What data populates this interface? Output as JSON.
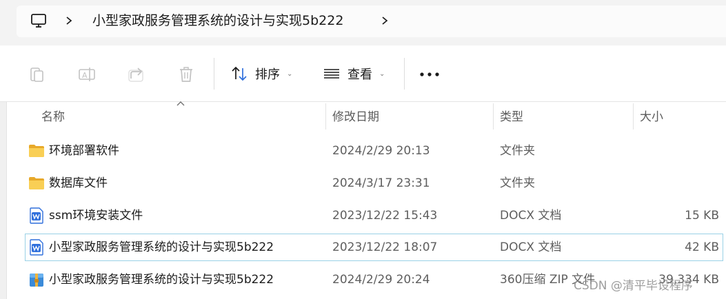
{
  "address_bar": {
    "breadcrumb": "小型家政服务管理系统的设计与实现5b222"
  },
  "toolbar": {
    "sort_label": "排序",
    "view_label": "查看",
    "icons": [
      "copy-icon",
      "rename-icon",
      "share-icon",
      "delete-icon",
      "sort-icon",
      "view-icon",
      "more-icon"
    ]
  },
  "columns": {
    "name": "名称",
    "modified": "修改日期",
    "type": "类型",
    "size": "大小"
  },
  "files": [
    {
      "name": "环境部署软件",
      "modified": "2024/2/29 20:13",
      "type": "文件夹",
      "size": "",
      "icon": "folder-icon"
    },
    {
      "name": "数据库文件",
      "modified": "2024/3/17 23:31",
      "type": "文件夹",
      "size": "",
      "icon": "folder-icon"
    },
    {
      "name": "ssm环境安装文件",
      "modified": "2023/12/22 15:43",
      "type": "DOCX 文档",
      "size": "15 KB",
      "icon": "wps-doc-icon"
    },
    {
      "name": "小型家政服务管理系统的设计与实现5b222",
      "modified": "2023/12/22 18:07",
      "type": "DOCX 文档",
      "size": "42 KB",
      "icon": "wps-doc-icon",
      "selected": true
    },
    {
      "name": "小型家政服务管理系统的设计与实现5b222",
      "modified": "2024/2/29 20:24",
      "type": "360压缩 ZIP 文件",
      "size": "39,334 KB",
      "icon": "zip-archive-icon"
    }
  ],
  "watermark": "CSDN @清平毕设程序",
  "colors": {
    "selection_border": "#99d1e6",
    "folder": "#f4c541",
    "wps_blue": "#2f6fdc"
  }
}
